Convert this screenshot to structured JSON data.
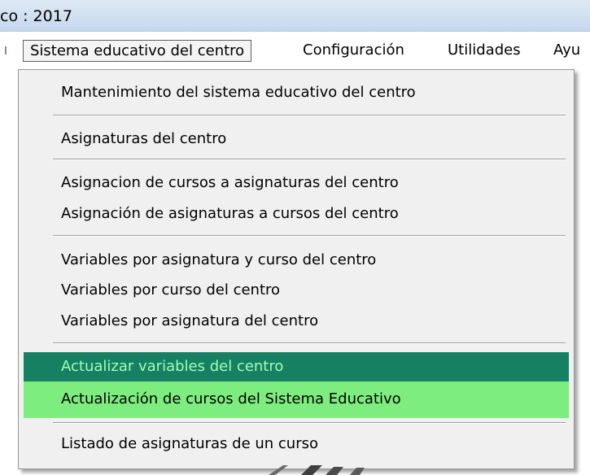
{
  "window": {
    "title": "co : 2017"
  },
  "menubar": {
    "items": [
      {
        "label": "Sistema educativo del centro",
        "open": true
      },
      {
        "label": "Configuración"
      },
      {
        "label": "Utilidades"
      },
      {
        "label": "Ayu"
      }
    ]
  },
  "dropdown": {
    "items": [
      {
        "label": "Mantenimiento del sistema educativo del centro"
      },
      {
        "label": "Asignaturas del centro"
      },
      {
        "label": "Asignacion de cursos a asignaturas del centro"
      },
      {
        "label": "Asignación de asignaturas a cursos del centro"
      },
      {
        "label": "Variables por asignatura y curso del centro"
      },
      {
        "label": "Variables por curso del centro"
      },
      {
        "label": "Variables por asignatura del centro"
      },
      {
        "label": "Actualizar variables del centro",
        "state": "hovered"
      },
      {
        "label": "Actualización de cursos del Sistema Educativo",
        "state": "highlighted"
      },
      {
        "label": "Listado de asignaturas de un curso"
      }
    ]
  },
  "colors": {
    "hover_bg": "#178062",
    "hover_text": "#9cffb9",
    "highlight_bg": "#7eed7f"
  }
}
